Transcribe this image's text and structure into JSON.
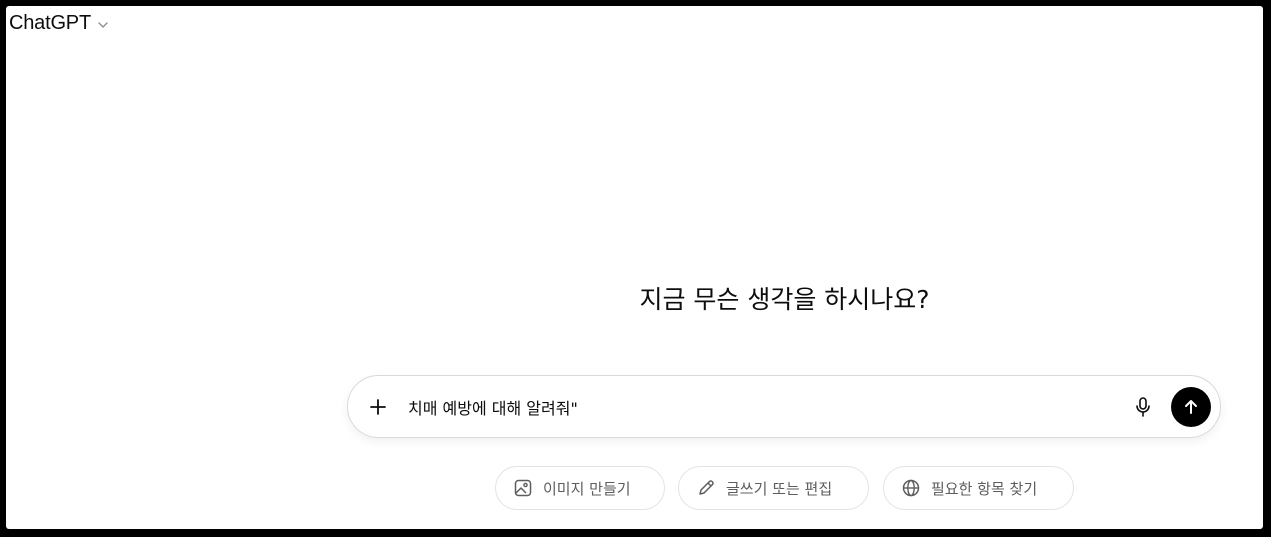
{
  "header": {
    "model_name": "ChatGPT",
    "dropdown_icon": "chevron-down-icon"
  },
  "main": {
    "headline": "지금 무슨 생각을 하시나요?"
  },
  "composer": {
    "text": "치매 예방에 대해 알려줘\"",
    "attach_icon": "plus-icon",
    "voice_icon": "microphone-icon",
    "send_icon": "arrow-up-icon"
  },
  "suggestions": [
    {
      "label": "이미지 만들기",
      "icon": "image-icon"
    },
    {
      "label": "글쓰기 또는 편집",
      "icon": "pencil-icon"
    },
    {
      "label": "필요한 항목 찾기",
      "icon": "globe-icon"
    }
  ],
  "colors": {
    "background": "#ffffff",
    "frame": "#000000",
    "text_primary": "#0d0d0d",
    "text_secondary": "#5d5d5d",
    "send_button": "#000000",
    "border": "#d9d9d9"
  }
}
